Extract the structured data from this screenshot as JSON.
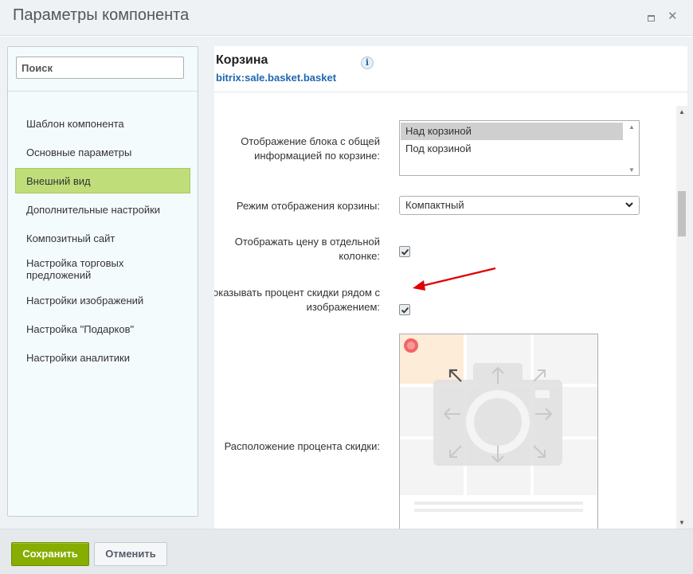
{
  "window": {
    "title": "Параметры компонента"
  },
  "sidebar": {
    "search_placeholder": "Поиск",
    "items": [
      {
        "label": "Шаблон компонента"
      },
      {
        "label": "Основные параметры"
      },
      {
        "label": "Внешний вид",
        "active": true
      },
      {
        "label": "Дополнительные настройки"
      },
      {
        "label": "Композитный сайт"
      },
      {
        "label": "Настройка торговых предложений"
      },
      {
        "label": "Настройки изображений"
      },
      {
        "label": "Настройка \"Подарков\""
      },
      {
        "label": "Настройки аналитики"
      }
    ]
  },
  "component": {
    "title": "Корзина",
    "id": "bitrix:sale.basket.basket",
    "info_icon": "i"
  },
  "params": {
    "total_block": {
      "label": "Отображение блока с общей информацией по корзине:",
      "options": [
        "Над корзиной",
        "Под корзиной"
      ],
      "selected": "Над корзиной"
    },
    "display_mode": {
      "label": "Режим отображения корзины:",
      "value": "Компактный"
    },
    "price_column": {
      "label": "Отображать цену в отдельной колонке:",
      "checked": true
    },
    "discount_near_image": {
      "label": "Показывать процент скидки рядом с изображением:",
      "checked": true
    },
    "discount_position": {
      "label": "Расположение процента скидки:"
    }
  },
  "footer": {
    "save_label": "Сохранить",
    "cancel_label": "Отменить"
  },
  "colors": {
    "active_nav": "#bfde7a",
    "save_button": "#86ad00",
    "link": "#2067b0",
    "annotation_arrow": "#e00000"
  }
}
